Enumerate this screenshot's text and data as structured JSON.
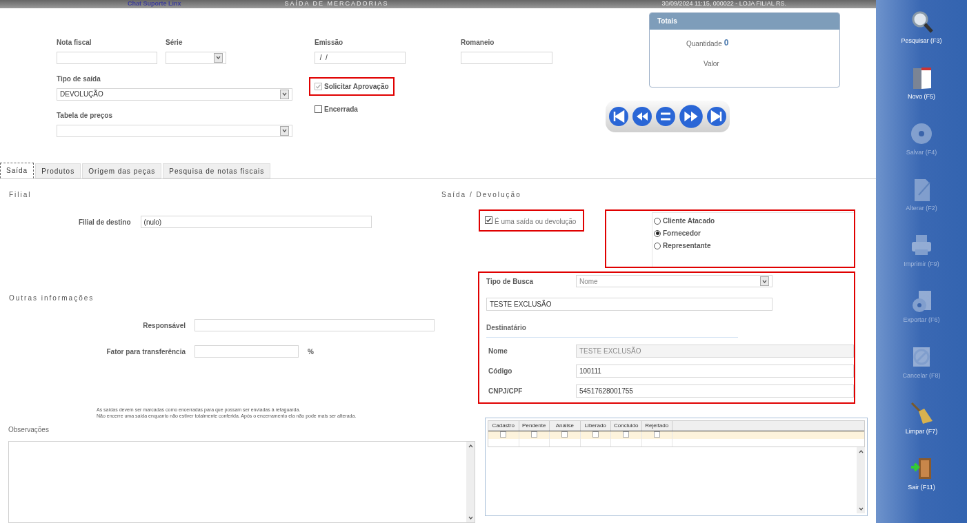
{
  "title_bar": {
    "chat": "Chat Suporte Linx",
    "title": "SAÍDA DE MERCADORIAS",
    "info": "30/09/2024 11:15, 000022 - LOJA FILIAL RS."
  },
  "header": {
    "nota_fiscal": {
      "label": "Nota fiscal"
    },
    "serie": {
      "label": "Série"
    },
    "emissao": {
      "label": "Emissão",
      "value": " /  /"
    },
    "romaneio": {
      "label": "Romaneio"
    },
    "tipo_saida": {
      "label": "Tipo de saída",
      "value": "DEVOLUÇÃO"
    },
    "tabela_precos": {
      "label": "Tabela de preços"
    },
    "checks": [
      {
        "label": "Solicitar Aprovação",
        "checked": true,
        "disabled": true,
        "highlighted": true
      },
      {
        "label": "Encerrada",
        "checked": false,
        "disabled": false,
        "highlighted": false
      }
    ]
  },
  "totais": {
    "title": "Totais",
    "quantidade_label": "Quantidade",
    "quantidade": "0",
    "valor_label": "Valor"
  },
  "tabs": [
    {
      "label": "Saída",
      "selected": true
    },
    {
      "label": "Produtos",
      "selected": false
    },
    {
      "label": "Origem das peças",
      "selected": false
    },
    {
      "label": "Pesquisa de notas fiscais",
      "selected": false
    }
  ],
  "filial": {
    "heading": "Filial",
    "label": "Filial de destino",
    "value": "(nulo)"
  },
  "outras": {
    "heading": "Outras informações",
    "responsavel": {
      "label": "Responsável"
    },
    "fator": {
      "label": "Fator para transferência",
      "unit": "%"
    }
  },
  "notes": [
    "As saídas devem ser marcadas como encerradas para que possam ser enviadas à retaguarda.",
    "Não encerre uma saída enquanto não estiver totalmente conferida. Após o encerramento ela não pode mais ser alterada."
  ],
  "observacoes": {
    "label": "Observações"
  },
  "saida_devolucao": {
    "heading": "Saída / Devolução",
    "check": {
      "label": "É uma saída ou devolução",
      "checked": true
    },
    "radios": [
      {
        "label": "Cliente Atacado",
        "selected": false
      },
      {
        "label": "Fornecedor",
        "selected": true
      },
      {
        "label": "Representante",
        "selected": false
      }
    ],
    "tipo_busca": {
      "label": "Tipo de Busca",
      "value": "Nome"
    },
    "busca": "TESTE EXCLUSÃO",
    "destinatario": "Destinatário",
    "fields": [
      {
        "label": "Nome",
        "value": "TESTE EXCLUSÃO",
        "disabled": true
      },
      {
        "label": "Código",
        "value": "100111",
        "disabled": false
      },
      {
        "label": "CNPJ/CPF",
        "value": "54517628001755",
        "disabled": false
      }
    ]
  },
  "status_grid": {
    "columns": [
      "Cadastro",
      "Pendente",
      "Analise",
      "Liberado",
      "Concluido",
      "Rejeitado"
    ],
    "checks": [
      false,
      false,
      false,
      false,
      false,
      false
    ]
  },
  "toolbar": [
    {
      "label": "Pesquisar (F3)",
      "kind": "search",
      "disabled": false
    },
    {
      "label": "Novo (F5)",
      "kind": "new",
      "disabled": false
    },
    {
      "label": "Salvar (F4)",
      "kind": "save",
      "disabled": true
    },
    {
      "label": "Alterar (F2)",
      "kind": "edit",
      "disabled": true
    },
    {
      "label": "Imprimir (F9)",
      "kind": "print",
      "disabled": true
    },
    {
      "label": "Exportar (F6)",
      "kind": "export",
      "disabled": true
    },
    {
      "label": "Cancelar (F8)",
      "kind": "cancel",
      "disabled": true
    },
    {
      "label": "Limpar (F7)",
      "kind": "clear",
      "disabled": false
    },
    {
      "label": "Sair (F11)",
      "kind": "exit",
      "disabled": false
    }
  ]
}
